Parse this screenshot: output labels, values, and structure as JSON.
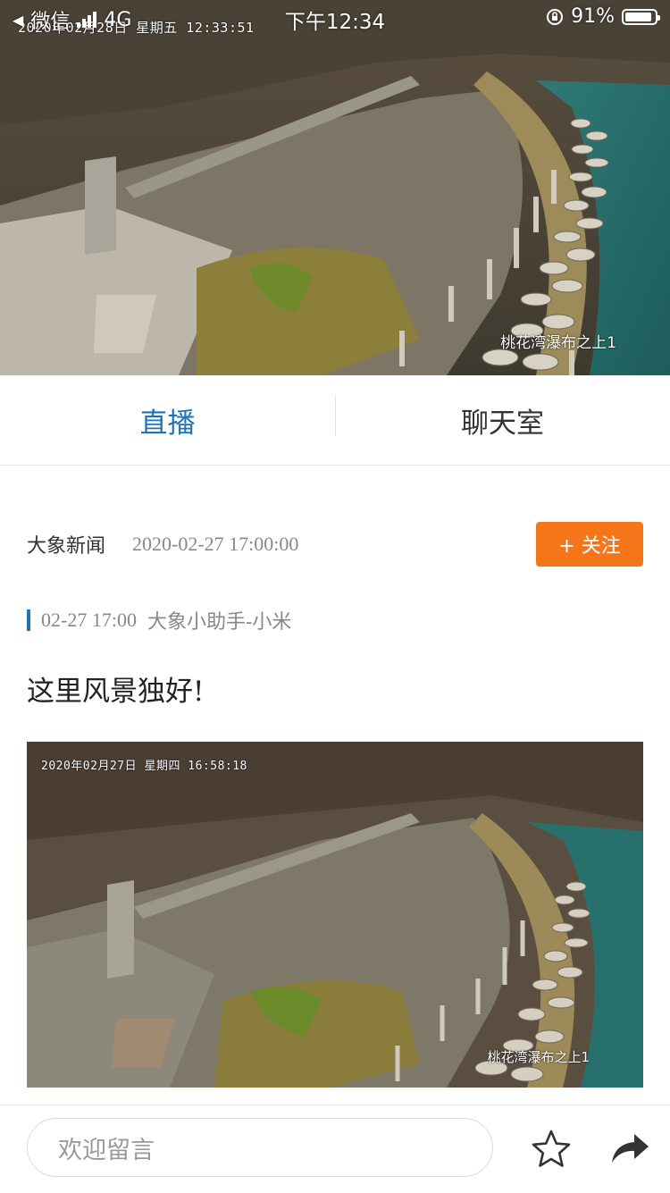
{
  "status_bar": {
    "carrier": "微信",
    "network": "4G",
    "time": "下午12:34",
    "battery": "91%",
    "battery_level": 0.91
  },
  "live_video": {
    "osd_time": "2020年02月28日  星期五  12:33:51",
    "location_label": "桃花湾瀑布之上1"
  },
  "tabs": [
    {
      "label": "直播",
      "active": true
    },
    {
      "label": "聊天室",
      "active": false
    }
  ],
  "post": {
    "author": "大象新闻",
    "timestamp": "2020-02-27 17:00:00",
    "follow_label": "+ 关注"
  },
  "message": {
    "time": "02-27 17:00",
    "sender": "大象小助手-小米",
    "text": "这里风景独好!",
    "photo_osd_time": "2020年02月27日  星期四  16:58:18",
    "photo_location_label": "桃花湾瀑布之上1"
  },
  "bottom_bar": {
    "comment_placeholder": "欢迎留言",
    "icons": [
      "star-icon",
      "share-icon"
    ]
  },
  "colors": {
    "accent_blue": "#1f73b7",
    "follow_orange": "#f5761a"
  }
}
